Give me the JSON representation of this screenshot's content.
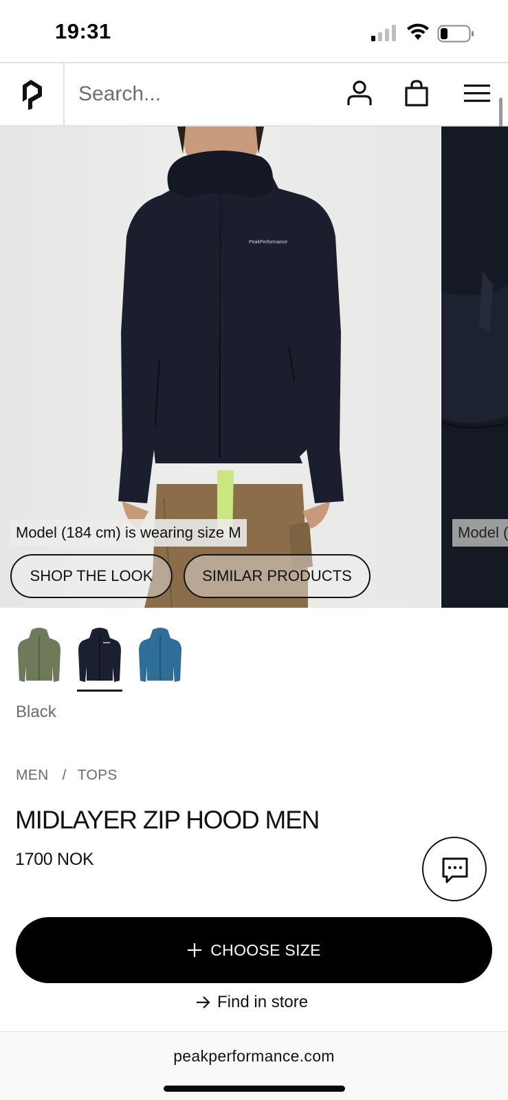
{
  "status_bar": {
    "time": "19:31",
    "icons": [
      "cellular-signal-icon",
      "wifi-icon",
      "battery-icon"
    ]
  },
  "header": {
    "logo": "peak-performance-logo",
    "search_placeholder": "Search...",
    "icons": [
      "account-icon",
      "shopping-bag-icon",
      "hamburger-menu-icon"
    ]
  },
  "gallery": {
    "model_caption": "Model (184 cm) is wearing size M",
    "model_caption_next": "Model (",
    "shop_the_look": "SHOP THE LOOK",
    "similar_products": "SIMILAR PRODUCTS"
  },
  "swatches": {
    "items": [
      {
        "name": "Green",
        "color": "#6f7a5a"
      },
      {
        "name": "Black",
        "color": "#1b2030"
      },
      {
        "name": "Blue",
        "color": "#2f6e97"
      }
    ],
    "selected_index": 1,
    "selected_label": "Black"
  },
  "product": {
    "breadcrumb": [
      "MEN",
      "TOPS"
    ],
    "breadcrumb_separator": "/",
    "title": "MIDLAYER ZIP HOOD MEN",
    "price": "1700 NOK"
  },
  "actions": {
    "choose_size": "CHOOSE SIZE",
    "find_in_store": "Find in store"
  },
  "browser": {
    "url": "peakperformance.com"
  },
  "colors": {
    "primary": "#000000",
    "muted_text": "#6a6a6a",
    "divider": "#e1e1e1"
  }
}
